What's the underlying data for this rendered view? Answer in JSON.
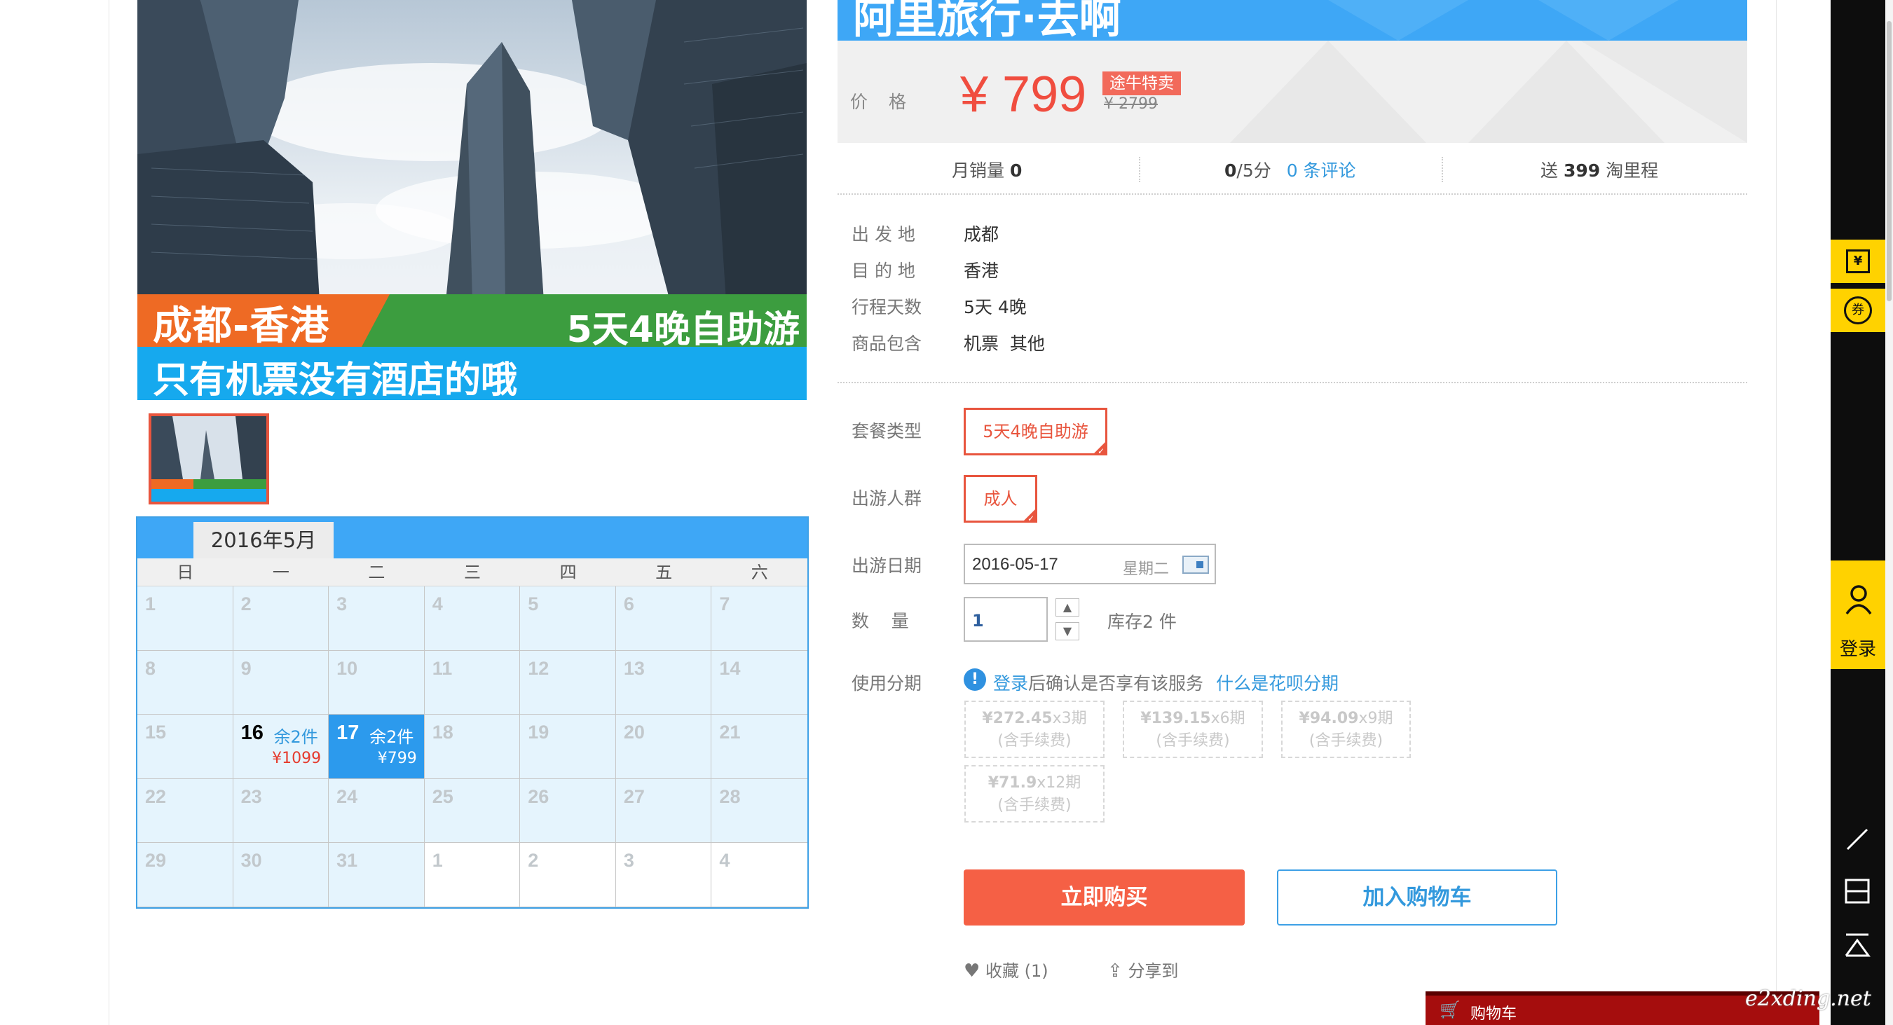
{
  "hero": {
    "route": "成都-香港",
    "days_tag": "5天4晚自助游",
    "note": "只有机票没有酒店的哦"
  },
  "calendar": {
    "month": "2016年5月",
    "weekdays": [
      "日",
      "一",
      "二",
      "三",
      "四",
      "五",
      "六"
    ],
    "days": [
      {
        "d": "1"
      },
      {
        "d": "2"
      },
      {
        "d": "3"
      },
      {
        "d": "4"
      },
      {
        "d": "5"
      },
      {
        "d": "6"
      },
      {
        "d": "7"
      },
      {
        "d": "8"
      },
      {
        "d": "9"
      },
      {
        "d": "10"
      },
      {
        "d": "11"
      },
      {
        "d": "12"
      },
      {
        "d": "13"
      },
      {
        "d": "14"
      },
      {
        "d": "15"
      },
      {
        "d": "16",
        "stock": "余2件",
        "price": "¥1099"
      },
      {
        "d": "17",
        "stock": "余2件",
        "price": "¥799",
        "selected": true
      },
      {
        "d": "18"
      },
      {
        "d": "19"
      },
      {
        "d": "20"
      },
      {
        "d": "21"
      },
      {
        "d": "22"
      },
      {
        "d": "23"
      },
      {
        "d": "24"
      },
      {
        "d": "25"
      },
      {
        "d": "26"
      },
      {
        "d": "27"
      },
      {
        "d": "28"
      },
      {
        "d": "29"
      },
      {
        "d": "30"
      },
      {
        "d": "31"
      },
      {
        "d": "1",
        "next_month": true
      },
      {
        "d": "2",
        "next_month": true
      },
      {
        "d": "3",
        "next_month": true
      },
      {
        "d": "4",
        "next_month": true
      }
    ]
  },
  "product": {
    "title": "阿里旅行·去啊",
    "price_label": "价格",
    "price": "¥ 799",
    "badge": "途牛特卖",
    "old_price": "¥ 2799"
  },
  "stats": {
    "monthly_sales_label": "月销量",
    "monthly_sales": "0",
    "rating": "0",
    "rating_suffix": "/5分",
    "reviews_link": "0 条评论",
    "mileage_label": "送",
    "mileage": "399",
    "mileage_suffix": "淘里程"
  },
  "info": [
    {
      "label": "出 发 地",
      "value": "成都"
    },
    {
      "label": "目 的 地",
      "value": "香港"
    },
    {
      "label": "行程天数",
      "value": "5天 4晚"
    },
    {
      "label": "商品包含",
      "value": "机票  其他"
    }
  ],
  "options": {
    "package_label": "套餐类型",
    "package_value": "5天4晚自助游",
    "group_label": "出游人群",
    "group_value": "成人",
    "date_label": "出游日期",
    "date_value": "2016-05-17",
    "date_weekday": "星期二",
    "qty_label": "数    量",
    "qty_value": "1",
    "stock_text": "库存2 件",
    "installment_label": "使用分期",
    "installment_login": "登录",
    "installment_note": "后确认是否享有该服务",
    "installment_link": "什么是花呗分期",
    "installments": [
      {
        "amount": "¥272.45",
        "period": "x3期",
        "fee": "(含手续费)"
      },
      {
        "amount": "¥139.15",
        "period": "x6期",
        "fee": "(含手续费)"
      },
      {
        "amount": "¥94.09",
        "period": "x9期",
        "fee": "(含手续费)"
      },
      {
        "amount": "¥71.9",
        "period": "x12期",
        "fee": "(含手续费)"
      }
    ]
  },
  "actions": {
    "buy_now": "立即购买",
    "add_to_cart": "加入购物车",
    "favorite": "收藏 (1)",
    "share": "分享到"
  },
  "sidebar": {
    "login": "登录",
    "cart": "购物车"
  },
  "watermark": "e2xding.net",
  "colors": {
    "accent_blue": "#3ea7f6",
    "price_red": "#f04d3f",
    "buy_orange": "#f56045",
    "sidebar_yellow": "#ffd200"
  }
}
